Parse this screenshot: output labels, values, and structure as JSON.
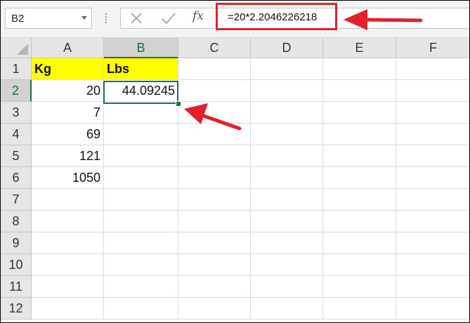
{
  "name_box": {
    "value": "B2"
  },
  "formula_bar": {
    "formula": "=20*2.2046226218",
    "icons": [
      "cancel-icon",
      "enter-check-icon",
      "insert-function-icon"
    ]
  },
  "columns": [
    "A",
    "B",
    "C",
    "D",
    "E",
    "F"
  ],
  "rows": [
    "1",
    "2",
    "3",
    "4",
    "5",
    "6",
    "7",
    "8",
    "9",
    "10",
    "11",
    "12"
  ],
  "cells": {
    "A1": "Kg",
    "B1": "Lbs",
    "A2": "20",
    "B2": "44.09245",
    "A3": "7",
    "A4": "69",
    "A5": "121",
    "A6": "1050"
  },
  "selected_cell": "B2",
  "colors": {
    "header_fill": "#ffff00",
    "selection": "#217346",
    "annotation": "#e0222d"
  }
}
